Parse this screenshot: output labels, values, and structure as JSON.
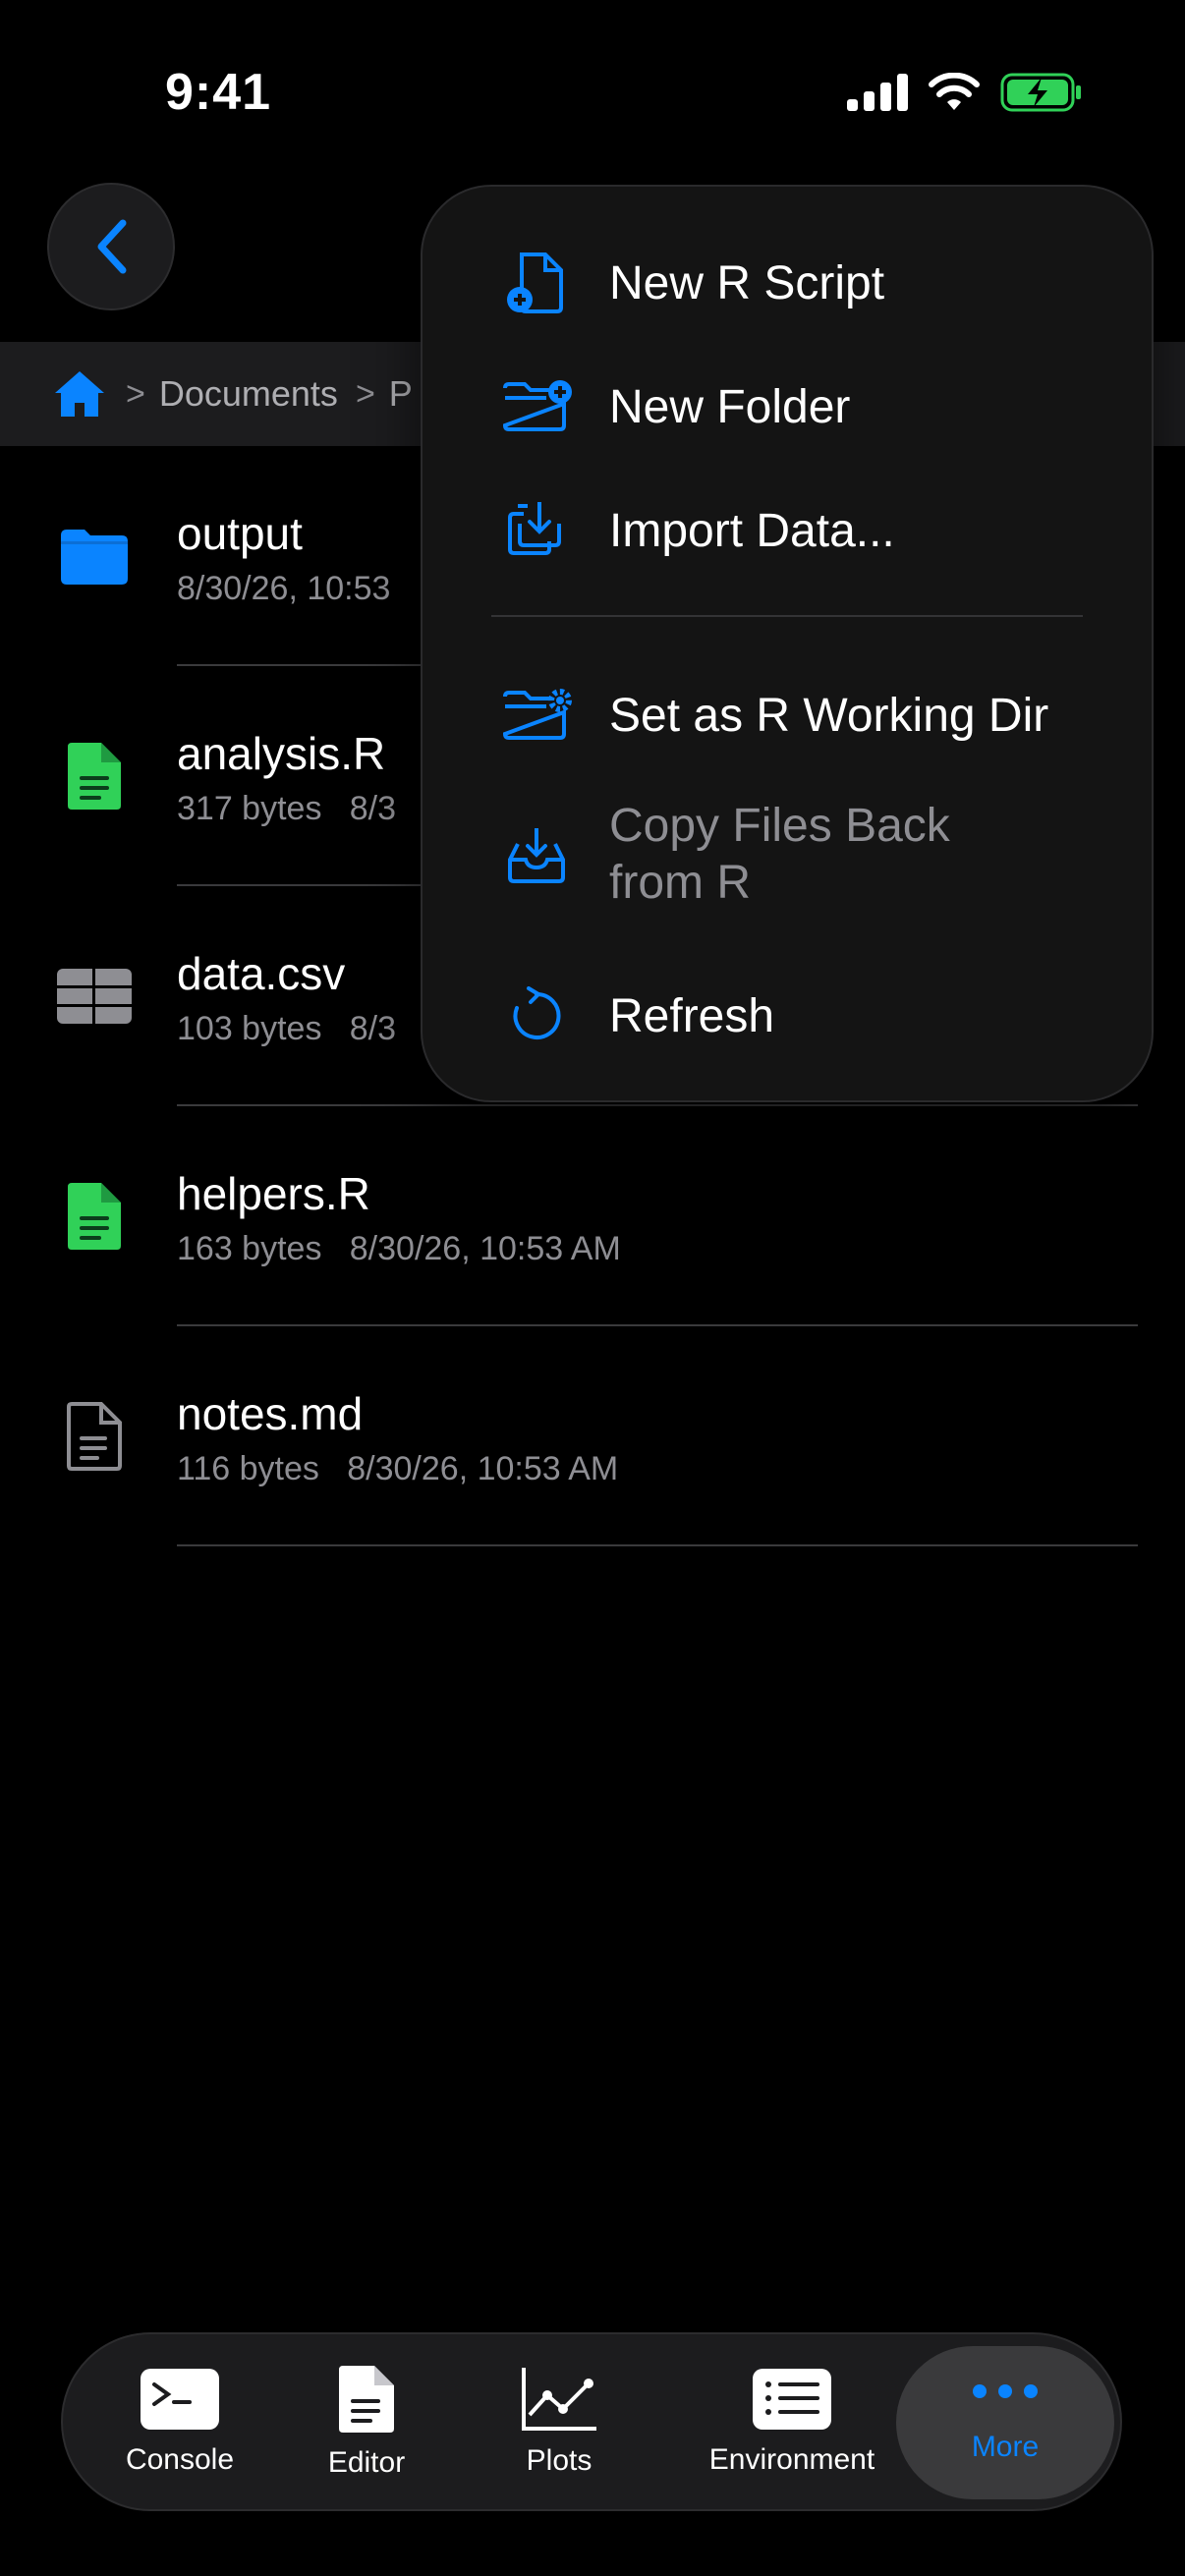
{
  "status_bar": {
    "time": "9:41"
  },
  "breadcrumb": {
    "items": [
      "Documents",
      "P"
    ]
  },
  "files": [
    {
      "name": "output",
      "meta": "8/30/26, 10:53",
      "type": "folder"
    },
    {
      "name": "analysis.R",
      "meta": "317 bytes   8/3",
      "type": "r-file"
    },
    {
      "name": "data.csv",
      "meta": "103 bytes   8/3",
      "type": "csv-table"
    },
    {
      "name": "helpers.R",
      "meta": "163 bytes   8/30/26, 10:53 AM",
      "type": "r-file"
    },
    {
      "name": "notes.md",
      "meta": "116 bytes   8/30/26, 10:53 AM",
      "type": "document"
    }
  ],
  "menu": {
    "items": [
      {
        "label": "New R Script",
        "icon": "new-r-script-icon"
      },
      {
        "label": "New Folder",
        "icon": "new-folder-icon"
      },
      {
        "label": "Import Data...",
        "icon": "import-icon"
      },
      {
        "label": "Set as R Working Dir",
        "icon": "folder-gear-icon"
      },
      {
        "label_line1": "Copy Files Back",
        "label_line2": "from R",
        "icon": "tray-download-icon",
        "disabled": true
      },
      {
        "label": "Refresh",
        "icon": "refresh-icon"
      }
    ]
  },
  "tabbar": {
    "tabs": [
      {
        "label": "Console"
      },
      {
        "label": "Editor"
      },
      {
        "label": "Plots"
      },
      {
        "label": "Environment"
      },
      {
        "label": "More",
        "active": true
      }
    ]
  },
  "colors": {
    "accent": "#0a84ff",
    "r_file": "#30d158",
    "folder": "#0a84ff",
    "background": "#000000"
  }
}
